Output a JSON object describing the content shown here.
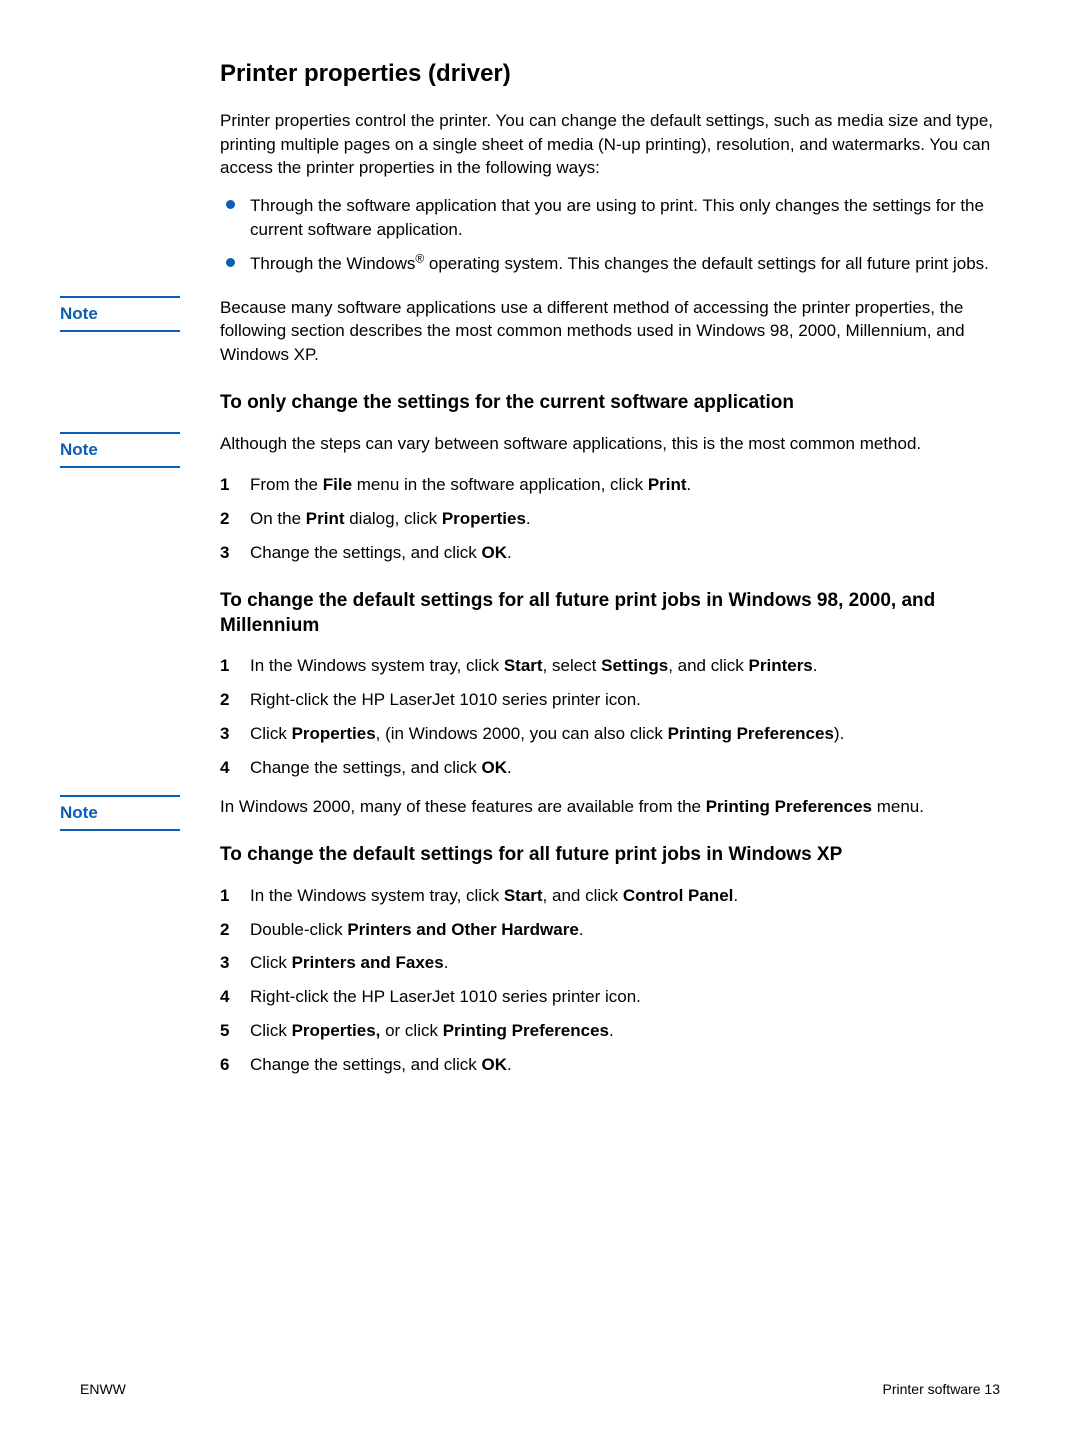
{
  "title": "Printer properties (driver)",
  "intro": "Printer properties control the printer. You can change the default settings, such as media size and type, printing multiple pages on a single sheet of media (N-up printing), resolution, and watermarks. You can access the printer properties in the following ways:",
  "bullets": [
    "Through the software application that you are using to print. This only changes the settings for the current software application.",
    "Through the Windows<sup>®</sup> operating system. This changes the default settings for all future print jobs."
  ],
  "note1": {
    "label": "Note",
    "text": "Because many software applications use a different method of accessing the printer properties, the following section describes the most common methods used in Windows 98, 2000, Millennium, and Windows XP."
  },
  "section1": {
    "heading": "To only change the settings for the current software application",
    "note": {
      "label": "Note",
      "text": "Although the steps can vary between software applications, this is the most common method."
    },
    "steps": [
      "From the <span class=\"b\">File</span> menu in the software application, click <span class=\"b\">Print</span>.",
      "On the <span class=\"b\">Print</span> dialog, click <span class=\"b\">Properties</span>.",
      "Change the settings, and click <span class=\"b\">OK</span>."
    ]
  },
  "section2": {
    "heading": "To change the default settings for all future print jobs in Windows 98, 2000, and Millennium",
    "steps": [
      "In the Windows system tray, click <span class=\"b\">Start</span>, select <span class=\"b\">Settings</span>, and click <span class=\"b\">Printers</span>.",
      "Right-click the HP LaserJet 1010 series printer icon.",
      "Click <span class=\"b\">Properties</span>, (in Windows 2000, you can also click <span class=\"b\">Printing Preferences</span>).",
      "Change the settings, and click <span class=\"b\">OK</span>."
    ],
    "note": {
      "label": "Note",
      "text": "In Windows 2000, many of these features are available from the <span class=\"b\">Printing Preferences</span> menu."
    }
  },
  "section3": {
    "heading": "To change the default settings for all future print jobs in Windows XP",
    "steps": [
      "In the Windows system tray, click <span class=\"b\">Start</span>, and click <span class=\"b\">Control Panel</span>.",
      "Double-click <span class=\"b\">Printers and Other Hardware</span>.",
      "Click <span class=\"b\">Printers and Faxes</span>.",
      "Right-click the HP LaserJet 1010 series printer icon.",
      "Click <span class=\"b\">Properties,</span> or click <span class=\"b\">Printing Preferences</span>.",
      "Change the settings, and click <span class=\"b\">OK</span>."
    ]
  },
  "footer": {
    "left": "ENWW",
    "right": "Printer software  13"
  }
}
